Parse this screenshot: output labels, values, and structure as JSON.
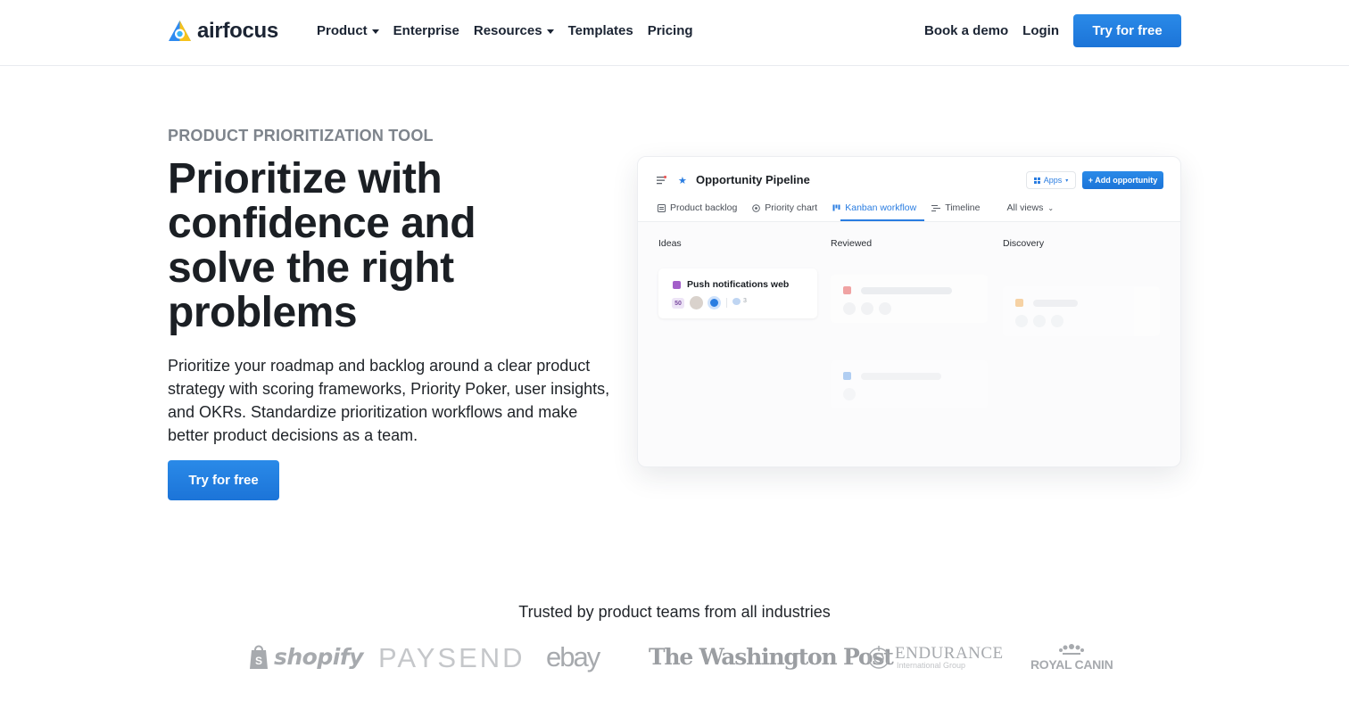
{
  "brand": {
    "name": "airfocus"
  },
  "nav": {
    "items": [
      {
        "label": "Product",
        "has_dropdown": true
      },
      {
        "label": "Enterprise",
        "has_dropdown": false
      },
      {
        "label": "Resources",
        "has_dropdown": true
      },
      {
        "label": "Templates",
        "has_dropdown": false
      },
      {
        "label": "Pricing",
        "has_dropdown": false
      }
    ],
    "book_demo": "Book a demo",
    "login": "Login",
    "cta": "Try for free"
  },
  "hero": {
    "eyebrow": "PRODUCT PRIORITIZATION TOOL",
    "title": "Prioritize with confidence and solve the right problems",
    "description": "Prioritize your roadmap and backlog around a clear product strategy with scoring frameworks, Priority Poker, user insights, and OKRs. Standardize prioritization workflows and make better product decisions as a team.",
    "cta": "Try for free"
  },
  "mockup": {
    "title": "Opportunity Pipeline",
    "apps_label": "Apps",
    "add_label": "+ Add opportunity",
    "tabs": [
      "Product backlog",
      "Priority chart",
      "Kanban workflow",
      "Timeline",
      "All views"
    ],
    "active_tab": "Kanban workflow",
    "columns": [
      "Ideas",
      "Reviewed",
      "Discovery"
    ],
    "card": {
      "title": "Push notifications web",
      "score": "50",
      "comments": "3"
    },
    "colors": {
      "accent": "#2a7de1",
      "card_icon": "#a35fc9",
      "reviewed_icon": "#e85c5c",
      "discovery_icon": "#f2a23a"
    }
  },
  "trusted": {
    "heading": "Trusted by product teams from all industries",
    "logos": [
      {
        "name": "shopify",
        "icon": "shopping-bag-icon"
      },
      {
        "name": "PAYSEND"
      },
      {
        "name": "ebay"
      },
      {
        "name": "The Washington Post"
      },
      {
        "name": "ENDURANCE",
        "sub": "International Group",
        "icon": "compass-emblem-icon"
      },
      {
        "name": "ROYAL CANIN",
        "icon": "crown-icon"
      }
    ]
  },
  "colors": {
    "primary": "#1f78dc",
    "text": "#1b1f24",
    "muted": "#7e848c",
    "logo_gray": "#a7aaae"
  }
}
